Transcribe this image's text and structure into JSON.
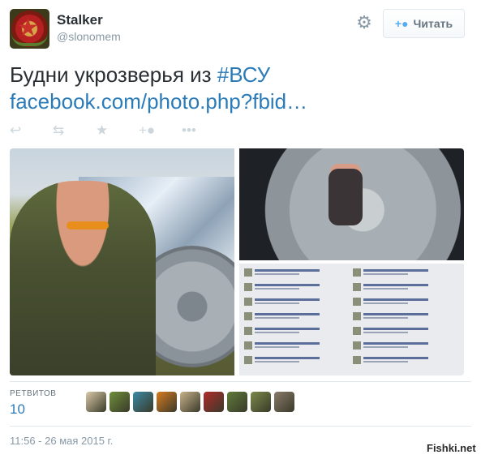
{
  "author": {
    "name": "Stalker",
    "handle": "@slonomem",
    "avatar_icon": "soviet-star-emblem"
  },
  "header_actions": {
    "settings_icon": "gear-icon",
    "follow_label": "Читать",
    "follow_icon": "add-user-icon"
  },
  "tweet": {
    "text_before": "Будни укрозверья из ",
    "hashtag": "#ВСУ",
    "link": "facebook.com/photo.php?fbid…"
  },
  "action_bar": [
    {
      "name": "reply-icon",
      "glyph": "↩"
    },
    {
      "name": "retweet-icon",
      "glyph": "⇄"
    },
    {
      "name": "favorite-icon",
      "glyph": "★"
    },
    {
      "name": "follow-icon",
      "glyph": "+👤"
    },
    {
      "name": "more-icon",
      "glyph": "•••"
    }
  ],
  "media": {
    "photos": [
      "soldier-with-wheel-photo",
      "hand-on-wheel-closeup-photo",
      "facebook-comments-screenshot"
    ]
  },
  "stats": {
    "retweets_label": "РЕТВИТОВ",
    "retweets_count": "10"
  },
  "retweeters_colors": [
    "#d9c9a8",
    "#6f8f3a",
    "#3a8aa6",
    "#d87a1e",
    "#c8b28c",
    "#b02a2a",
    "#5f7a3a",
    "#7a8a4a",
    "#8a7a6a"
  ],
  "timestamp": "11:56 - 26 мая 2015 г.",
  "watermark": "Fishki.net"
}
